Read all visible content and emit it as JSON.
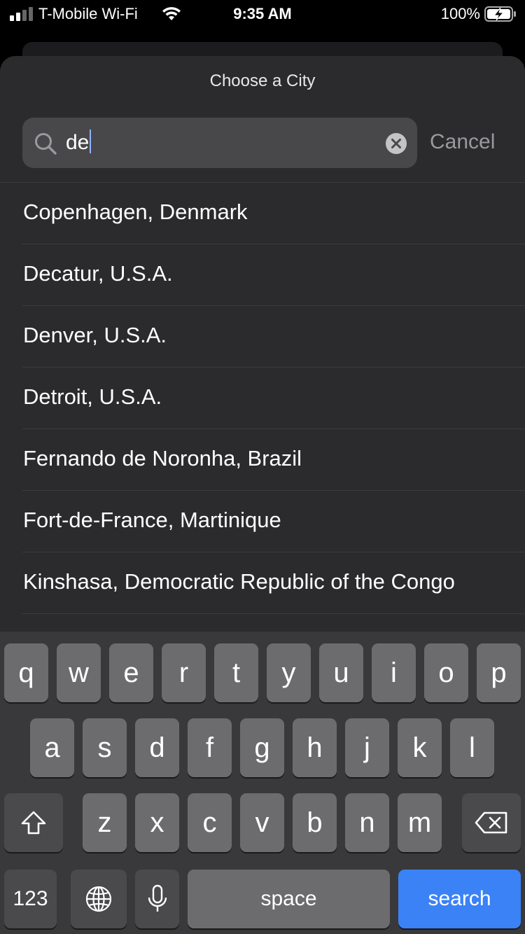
{
  "status_bar": {
    "carrier": "T-Mobile Wi-Fi",
    "time": "9:35 AM",
    "battery": "100%",
    "icons": [
      "signal-icon",
      "wifi-icon",
      "battery-charging-icon"
    ]
  },
  "sheet": {
    "title": "Choose a City",
    "search": {
      "value": "de",
      "cancel_label": "Cancel",
      "icons": [
        "search-icon",
        "clear-icon"
      ]
    },
    "results": [
      "Copenhagen, Denmark",
      "Decatur, U.S.A.",
      "Denver, U.S.A.",
      "Detroit, U.S.A.",
      "Fernando de Noronha, Brazil",
      "Fort-de-France, Martinique",
      "Kinshasa, Democratic Republic of the Congo"
    ]
  },
  "keyboard": {
    "row1": [
      "q",
      "w",
      "e",
      "r",
      "t",
      "y",
      "u",
      "i",
      "o",
      "p"
    ],
    "row2": [
      "a",
      "s",
      "d",
      "f",
      "g",
      "h",
      "j",
      "k",
      "l"
    ],
    "row3": [
      "z",
      "x",
      "c",
      "v",
      "b",
      "n",
      "m"
    ],
    "numbers_label": "123",
    "space_label": "space",
    "search_label": "search",
    "icons": [
      "shift-icon",
      "backspace-icon",
      "globe-icon",
      "microphone-icon"
    ],
    "accent_color": "#3a82f6"
  }
}
